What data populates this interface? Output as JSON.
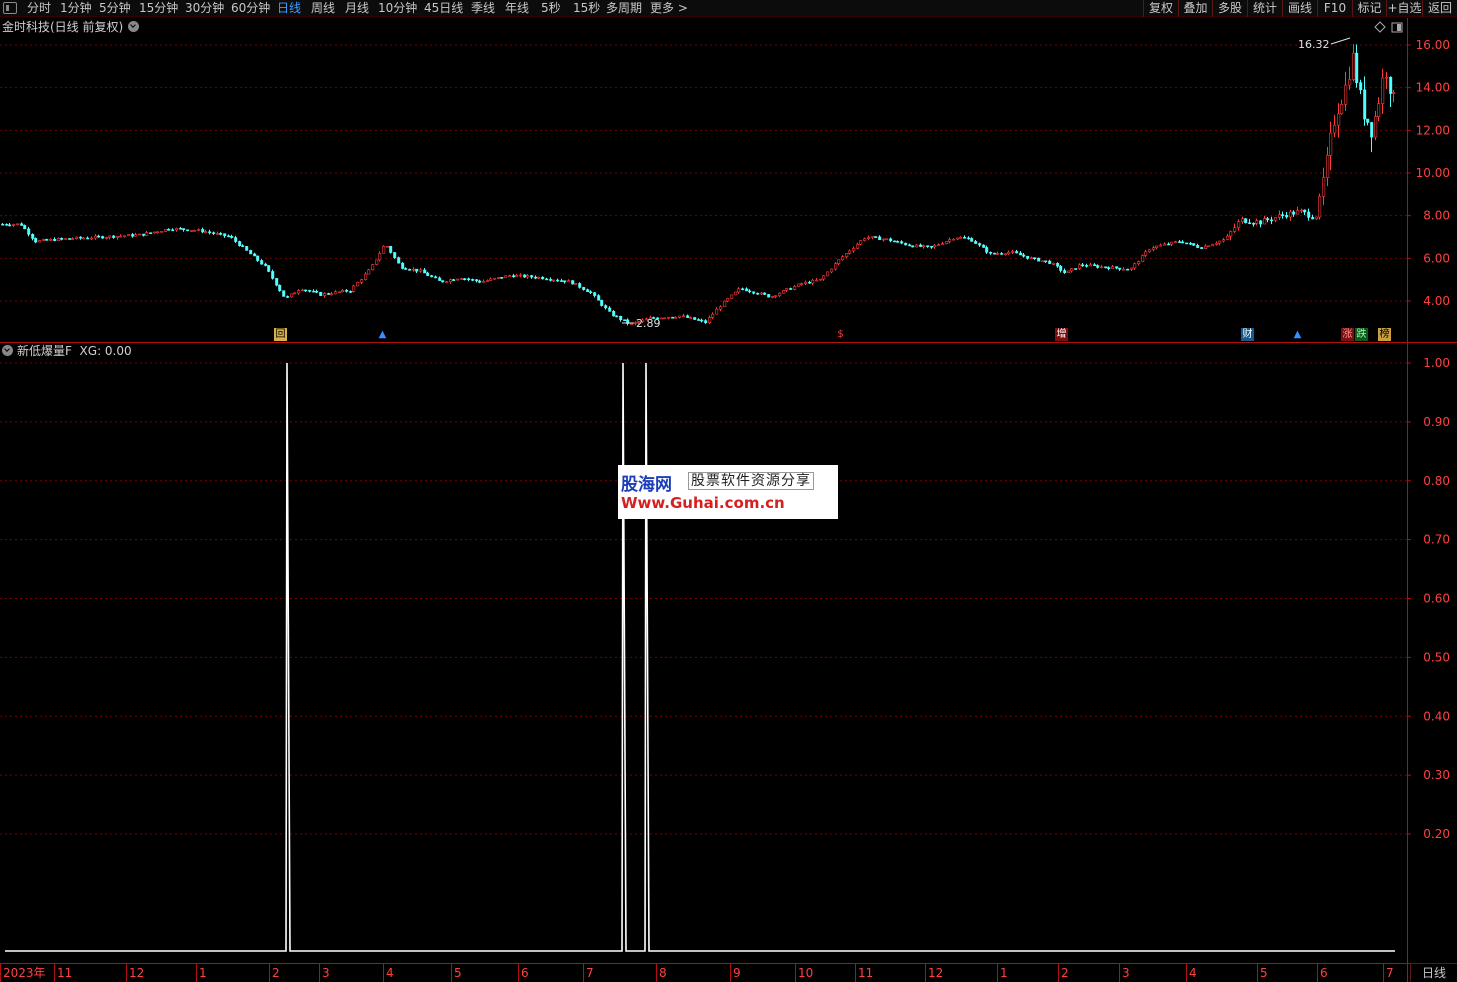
{
  "toolbar": {
    "periods": [
      {
        "label": "分时",
        "active": false
      },
      {
        "label": "1分钟",
        "active": false
      },
      {
        "label": "5分钟",
        "active": false
      },
      {
        "label": "15分钟",
        "active": false
      },
      {
        "label": "30分钟",
        "active": false
      },
      {
        "label": "60分钟",
        "active": false
      },
      {
        "label": "日线",
        "active": true
      },
      {
        "label": "周线",
        "active": false
      },
      {
        "label": "月线",
        "active": false
      },
      {
        "label": "10分钟",
        "active": false
      },
      {
        "label": "45日线",
        "active": false
      },
      {
        "label": "季线",
        "active": false
      },
      {
        "label": "年线",
        "active": false
      },
      {
        "label": "5秒",
        "active": false
      },
      {
        "label": "15秒",
        "active": false
      },
      {
        "label": "多周期",
        "active": false
      },
      {
        "label": "更多 >",
        "active": false
      }
    ],
    "actions": [
      "复权",
      "叠加",
      "多股",
      "统计",
      "画线",
      "F10",
      "标记",
      "+自选",
      "返回"
    ]
  },
  "stock_header": {
    "title": "金时科技(日线 前复权)"
  },
  "main_chart": {
    "price_axis": [
      "16.00",
      "14.00",
      "12.00",
      "10.00",
      "8.00",
      "6.00",
      "4.00"
    ],
    "high_annotation": "16.32",
    "low_annotation": "2.89",
    "event_markers": [
      "回",
      "▲",
      "$",
      "增",
      "财",
      "▲",
      "涨",
      "跌",
      "榜"
    ],
    "colors": {
      "up": "#ff3c3c",
      "down": "#54ffff",
      "grid": "#7a0000",
      "axis_line": "#b01010"
    }
  },
  "indicator": {
    "title": "新低爆量F",
    "value_text": "XG: 0.00",
    "axis": [
      "1.00",
      "0.90",
      "0.80",
      "0.70",
      "0.60",
      "0.50",
      "0.40",
      "0.30",
      "0.20"
    ],
    "line_color": "#ffffff"
  },
  "x_axis": {
    "labels": [
      "2023年",
      "11",
      "12",
      "1",
      "2",
      "3",
      "4",
      "5",
      "6",
      "7",
      "8",
      "9",
      "10",
      "11",
      "12",
      "1",
      "2",
      "3",
      "4",
      "5",
      "6",
      "7"
    ],
    "period_label": "日线"
  },
  "watermark": {
    "logo": "股海网",
    "tagline": "股票软件资源分享",
    "url": "Www.Guhai.com.cn"
  }
}
